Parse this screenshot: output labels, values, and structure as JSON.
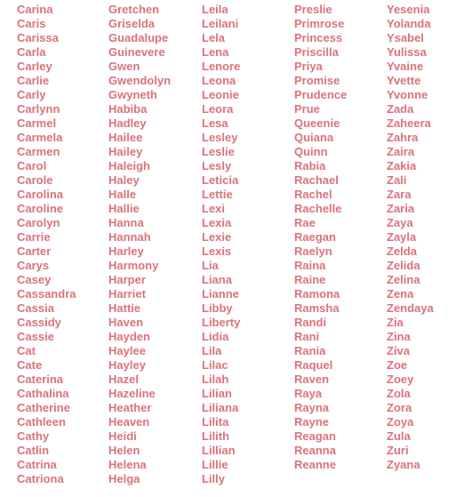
{
  "text_color": "#d9737a",
  "columns": [
    [
      "Carina",
      "Caris",
      "Carissa",
      "Carla",
      "Carley",
      "Carlie",
      "Carly",
      "Carlynn",
      "Carmel",
      "Carmela",
      "Carmen",
      "Carol",
      "Carole",
      "Carolina",
      "Caroline",
      "Carolyn",
      "Carrie",
      "Carter",
      "Carys",
      "Casey",
      "Cassandra",
      "Cassia",
      "Cassidy",
      "Cassie",
      "Cat",
      "Cate",
      "Caterina",
      "Cathalina",
      "Catherine",
      "Cathleen",
      "Cathy",
      "Catlin",
      "Catrina",
      "Catriona"
    ],
    [
      "Gretchen",
      "Griselda",
      "Guadalupe",
      "Guinevere",
      "Gwen",
      "Gwendolyn",
      "Gwyneth",
      "Habiba",
      "Hadley",
      "Hailee",
      "Hailey",
      "Haleigh",
      "Haley",
      "Halle",
      "Hallie",
      "Hanna",
      "Hannah",
      "Harley",
      "Harmony",
      "Harper",
      "Harriet",
      "Hattie",
      "Haven",
      "Hayden",
      "Haylee",
      "Hayley",
      "Hazel",
      "Hazeline",
      "Heather",
      "Heaven",
      "Heidi",
      "Helen",
      "Helena",
      "Helga"
    ],
    [
      "Leila",
      "Leilani",
      "Lela",
      "Lena",
      "Lenore",
      "Leona",
      "Leonie",
      "Leora",
      "Lesa",
      "Lesley",
      "Leslie",
      "Lesly",
      "Leticia",
      "Lettie",
      "Lexi",
      "Lexia",
      "Lexie",
      "Lexis",
      "Lia",
      "Liana",
      "Lianne",
      "Libby",
      "Liberty",
      "Lidia",
      "Lila",
      "Lilac",
      "Lilah",
      "Lilian",
      "Liliana",
      "Lilita",
      "Lilith",
      "Lillian",
      "Lillie",
      "Lilly"
    ],
    [
      "Preslie",
      "Primrose",
      "Princess",
      "Priscilla",
      "Priya",
      "Promise",
      "Prudence",
      "Prue",
      "Queenie",
      "Quiana",
      "Quinn",
      "Rabia",
      "Rachael",
      "Rachel",
      "Rachelle",
      "Rae",
      "Raegan",
      "Raelyn",
      "Raina",
      "Raine",
      "Ramona",
      "Ramsha",
      "Randi",
      "Rani",
      "Rania",
      "Raquel",
      "Raven",
      "Raya",
      "Rayna",
      "Rayne",
      "Reagan",
      "Reanna",
      "Reanne"
    ],
    [
      "Yesenia",
      "Yolanda",
      "Ysabel",
      "Yulissa",
      "Yvaine",
      "Yvette",
      "Yvonne",
      "Zada",
      "Zaheera",
      "Zahra",
      "Zaira",
      "Zakia",
      "Zali",
      "Zara",
      "Zaria",
      "Zaya",
      "Zayla",
      "Zelda",
      "Zelida",
      "Zelina",
      "Zena",
      "Zendaya",
      "Zia",
      "Zina",
      "Ziva",
      "Zoe",
      "Zoey",
      "Zola",
      "Zora",
      "Zoya",
      "Zula",
      "Zuri",
      "Zyana"
    ]
  ]
}
